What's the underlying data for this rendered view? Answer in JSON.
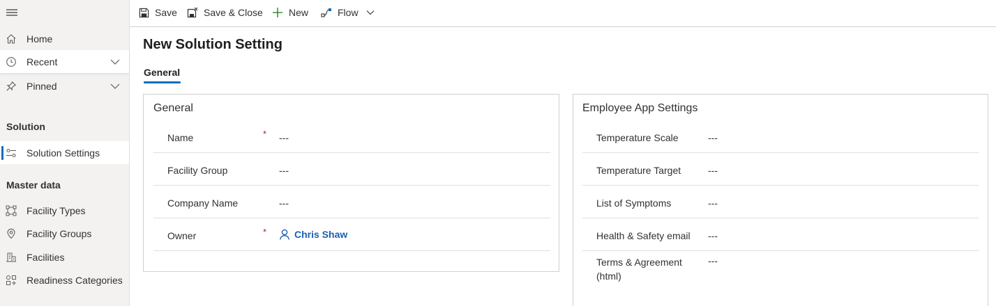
{
  "sidebar": {
    "top_items": [
      {
        "label": "Home",
        "icon": "home-icon"
      },
      {
        "label": "Recent",
        "icon": "clock-icon"
      },
      {
        "label": "Pinned",
        "icon": "pin-icon"
      }
    ],
    "sections": [
      {
        "heading": "Solution",
        "items": [
          {
            "label": "Solution Settings",
            "icon": "settings-sliders-icon",
            "selected": true
          }
        ]
      },
      {
        "heading": "Master data",
        "items": [
          {
            "label": "Facility Types",
            "icon": "facility-types-icon"
          },
          {
            "label": "Facility Groups",
            "icon": "location-pin-icon"
          },
          {
            "label": "Facilities",
            "icon": "building-icon"
          },
          {
            "label": "Readiness Categories",
            "icon": "categories-icon"
          }
        ]
      }
    ]
  },
  "toolbar": {
    "save": "Save",
    "save_close": "Save & Close",
    "new": "New",
    "flow": "Flow"
  },
  "page": {
    "title": "New Solution Setting",
    "tab": "General"
  },
  "general_card": {
    "title": "General",
    "fields": [
      {
        "label": "Name",
        "required": true,
        "value": "---"
      },
      {
        "label": "Facility Group",
        "required": false,
        "value": "---"
      },
      {
        "label": "Company Name",
        "required": false,
        "value": "---"
      },
      {
        "label": "Owner",
        "required": true,
        "value": "Chris Shaw"
      }
    ],
    "required_marker": "*"
  },
  "employee_card": {
    "title": "Employee App Settings",
    "fields": [
      {
        "label": "Temperature Scale",
        "value": "---"
      },
      {
        "label": "Temperature Target",
        "value": "---"
      },
      {
        "label": "List of Symptoms",
        "value": "---"
      },
      {
        "label": "Health & Safety email",
        "value": "---"
      },
      {
        "label": "Terms & Agreement (html)",
        "value": "---"
      }
    ]
  },
  "colors": {
    "accent": "#0f6cbd",
    "link": "#1b5fb4",
    "required": "#a4262c",
    "sidebar_bg": "#f3f2f1"
  }
}
